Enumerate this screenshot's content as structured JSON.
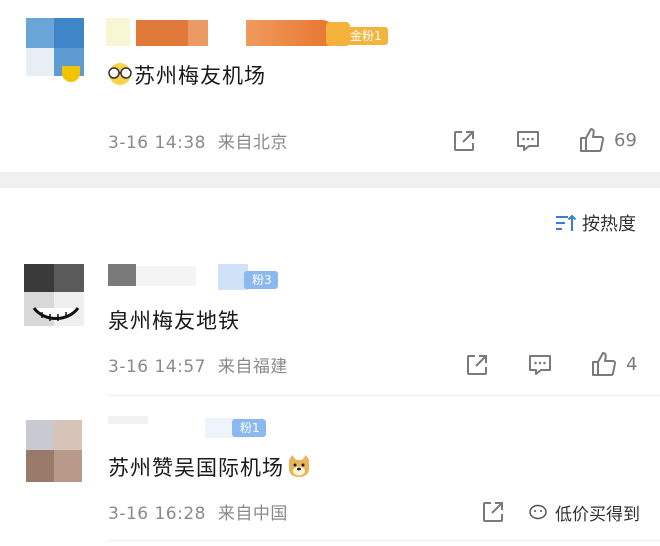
{
  "comments": [
    {
      "badge": "金粉1",
      "text": "苏州梅友机场",
      "leading_emoji": "glasses-face",
      "time": "3-16 14:38",
      "location": "来自北京",
      "likes": "69"
    },
    {
      "badge": "粉3",
      "text": "泉州梅友地铁",
      "time": "3-16 14:57",
      "location": "来自福建",
      "likes": "4"
    },
    {
      "badge": "粉1",
      "text": "苏州赞吴国际机场",
      "trailing_emoji": "doge",
      "time": "3-16 16:28",
      "location": "来自中国"
    }
  ],
  "sort": {
    "label": "按热度",
    "icon": "sort-icon"
  },
  "watermark": {
    "text": "低价买得到"
  },
  "colors": {
    "meta": "#8a8a8a",
    "gold_badge": "#f3b33d",
    "blue_badge": "#8bb8ef",
    "divider": "#f0f0f0"
  }
}
